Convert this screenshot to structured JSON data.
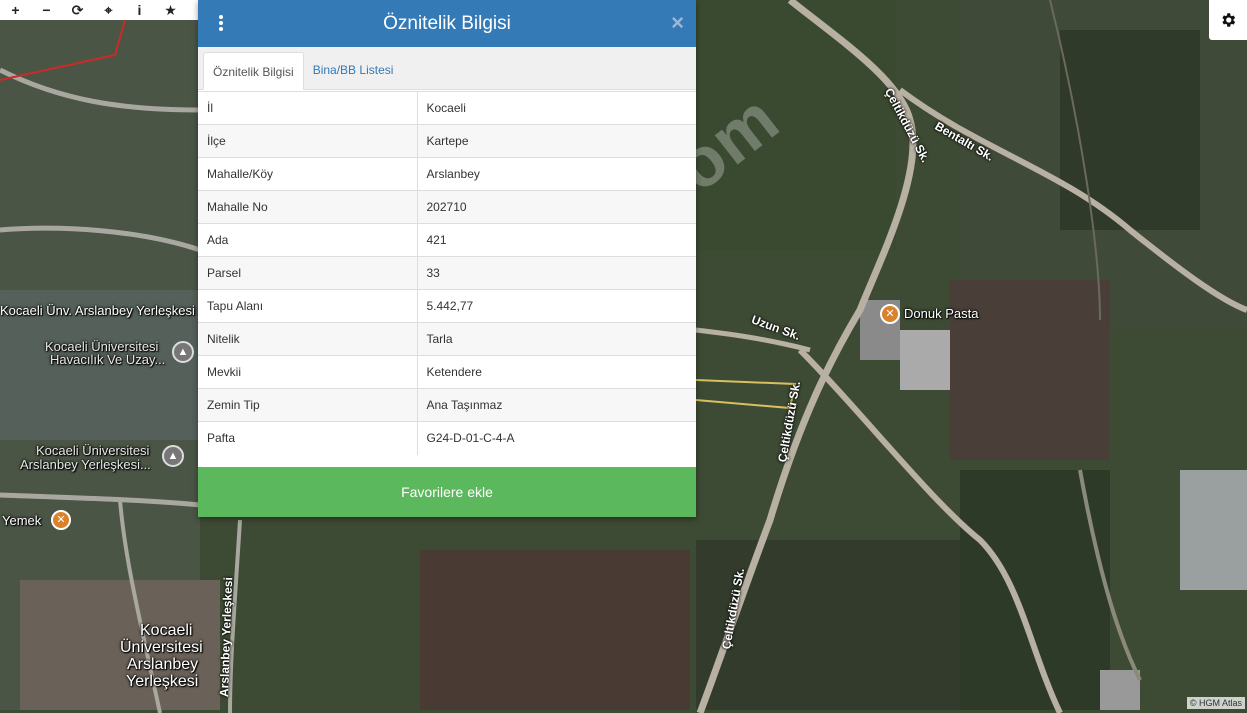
{
  "toolbar": {
    "buttons": [
      {
        "icon": "zoom-in-icon",
        "glyph": "+"
      },
      {
        "icon": "zoom-out-icon",
        "glyph": "−"
      },
      {
        "icon": "refresh-icon",
        "glyph": "⟳"
      },
      {
        "icon": "locate-icon",
        "glyph": "⌖"
      },
      {
        "icon": "info-icon",
        "glyph": "i"
      },
      {
        "icon": "star-icon",
        "glyph": "★"
      }
    ],
    "settings_icon": "gear-icon"
  },
  "panel": {
    "title": "Öznitelik Bilgisi",
    "tabs": [
      {
        "label": "Öznitelik Bilgisi",
        "active": true
      },
      {
        "label": "Bina/BB Listesi",
        "active": false
      }
    ],
    "rows": [
      {
        "key": "İl",
        "value": "Kocaeli"
      },
      {
        "key": "İlçe",
        "value": "Kartepe"
      },
      {
        "key": "Mahalle/Köy",
        "value": "Arslanbey"
      },
      {
        "key": "Mahalle No",
        "value": "202710"
      },
      {
        "key": "Ada",
        "value": "421"
      },
      {
        "key": "Parsel",
        "value": "33"
      },
      {
        "key": "Tapu Alanı",
        "value": "5.442,77"
      },
      {
        "key": "Nitelik",
        "value": "Tarla"
      },
      {
        "key": "Mevkii",
        "value": "Ketendere"
      },
      {
        "key": "Zemin Tip",
        "value": "Ana Taşınmaz"
      },
      {
        "key": "Pafta",
        "value": "G24-D-01-C-4-A"
      }
    ],
    "favorite_button": "Favorilere ekle",
    "header_color": "#337ab7",
    "button_color": "#5cb85c"
  },
  "map": {
    "labels": {
      "campus_main": "Kocaeli Ünv. Arslanbey Yerleşkesi",
      "havacilik_1": "Kocaeli Üniversitesi",
      "havacilik_2": "Havacılık Ve Uzay...",
      "arslanbey_1": "Kocaeli Üniversitesi",
      "arslanbey_2": "Arslanbey Yerleşkesi...",
      "yemek": "Yemek",
      "big_1": "Kocaeli",
      "big_2": "Üniversitesi",
      "big_3": "Arslanbey",
      "big_4": "Yerleşkesi",
      "donuk": "Donuk Pasta"
    },
    "roads": {
      "celtikduzu_top": "Çeltikdüzü Sk.",
      "bentalti": "Bentaltı Sk.",
      "uzun": "Uzun Sk.",
      "celtikduzu_mid": "Çeltikdüzü Sk.",
      "celtikduzu_bottom": "Çeltikdüzü Sk.",
      "arslanbey_yerleskesi": "Arslanbey Yerleşkesi"
    },
    "watermark": "emlakjet.com",
    "attribution": "© HGM Atlas"
  }
}
